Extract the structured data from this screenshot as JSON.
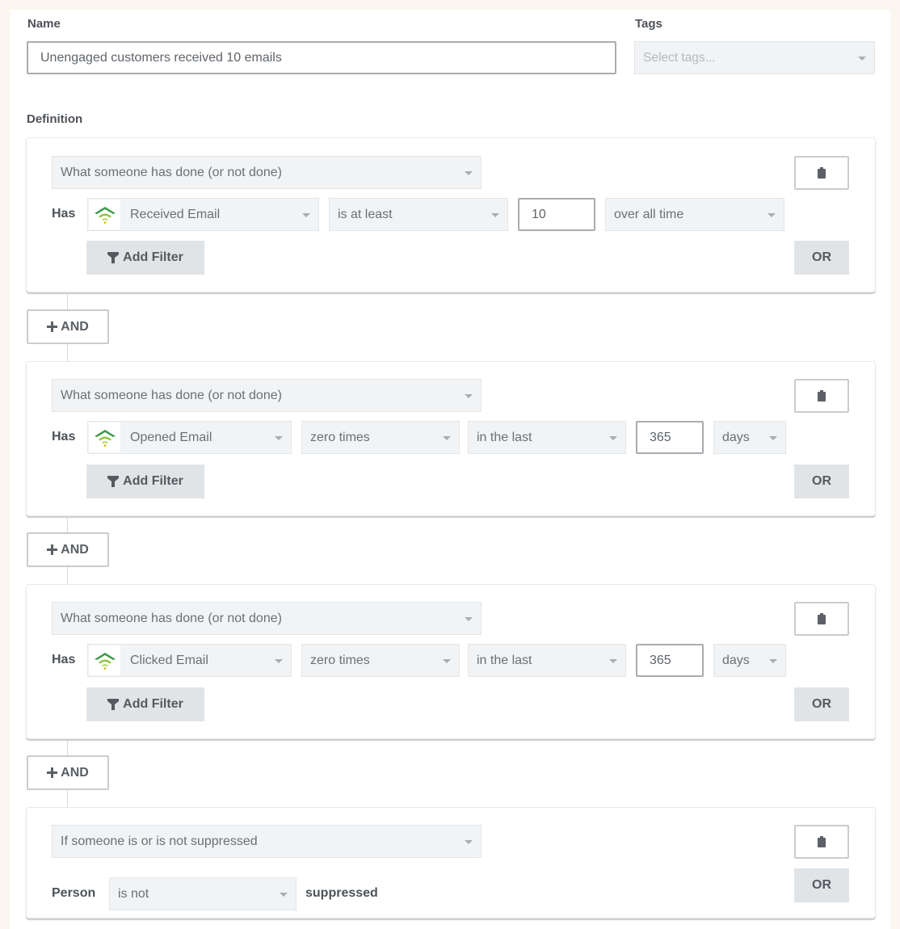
{
  "form": {
    "name_label": "Name",
    "name_value": "Unengaged customers received 10 emails",
    "tags_label": "Tags",
    "tags_placeholder": "Select tags...",
    "definition_label": "Definition"
  },
  "conditions": [
    {
      "type": "What someone has done (or not done)",
      "prefix": "Has",
      "metric": "Received Email",
      "operator": "is at least",
      "count": "10",
      "timeframe": "over all time",
      "add_filter": "Add Filter",
      "or": "OR"
    },
    {
      "type": "What someone has done (or not done)",
      "prefix": "Has",
      "metric": "Opened Email",
      "operator": "zero times",
      "timeframe": "in the last",
      "count": "365",
      "unit": "days",
      "add_filter": "Add Filter",
      "or": "OR"
    },
    {
      "type": "What someone has done (or not done)",
      "prefix": "Has",
      "metric": "Clicked Email",
      "operator": "zero times",
      "timeframe": "in the last",
      "count": "365",
      "unit": "days",
      "add_filter": "Add Filter",
      "or": "OR"
    },
    {
      "type": "If someone is or is not suppressed",
      "prefix": "Person",
      "operator": "is not",
      "suffix": "suppressed",
      "or": "OR"
    }
  ],
  "and_button": "AND",
  "icons": {
    "metric": "signal-wifi-icon",
    "filter": "funnel-icon",
    "delete": "trash-icon",
    "and": "plus-icon"
  },
  "colors": {
    "metric_icon_dark": "#3f9a4a",
    "metric_icon_light": "#8cc63f",
    "metric_icon_dot": "#d7c23a"
  }
}
